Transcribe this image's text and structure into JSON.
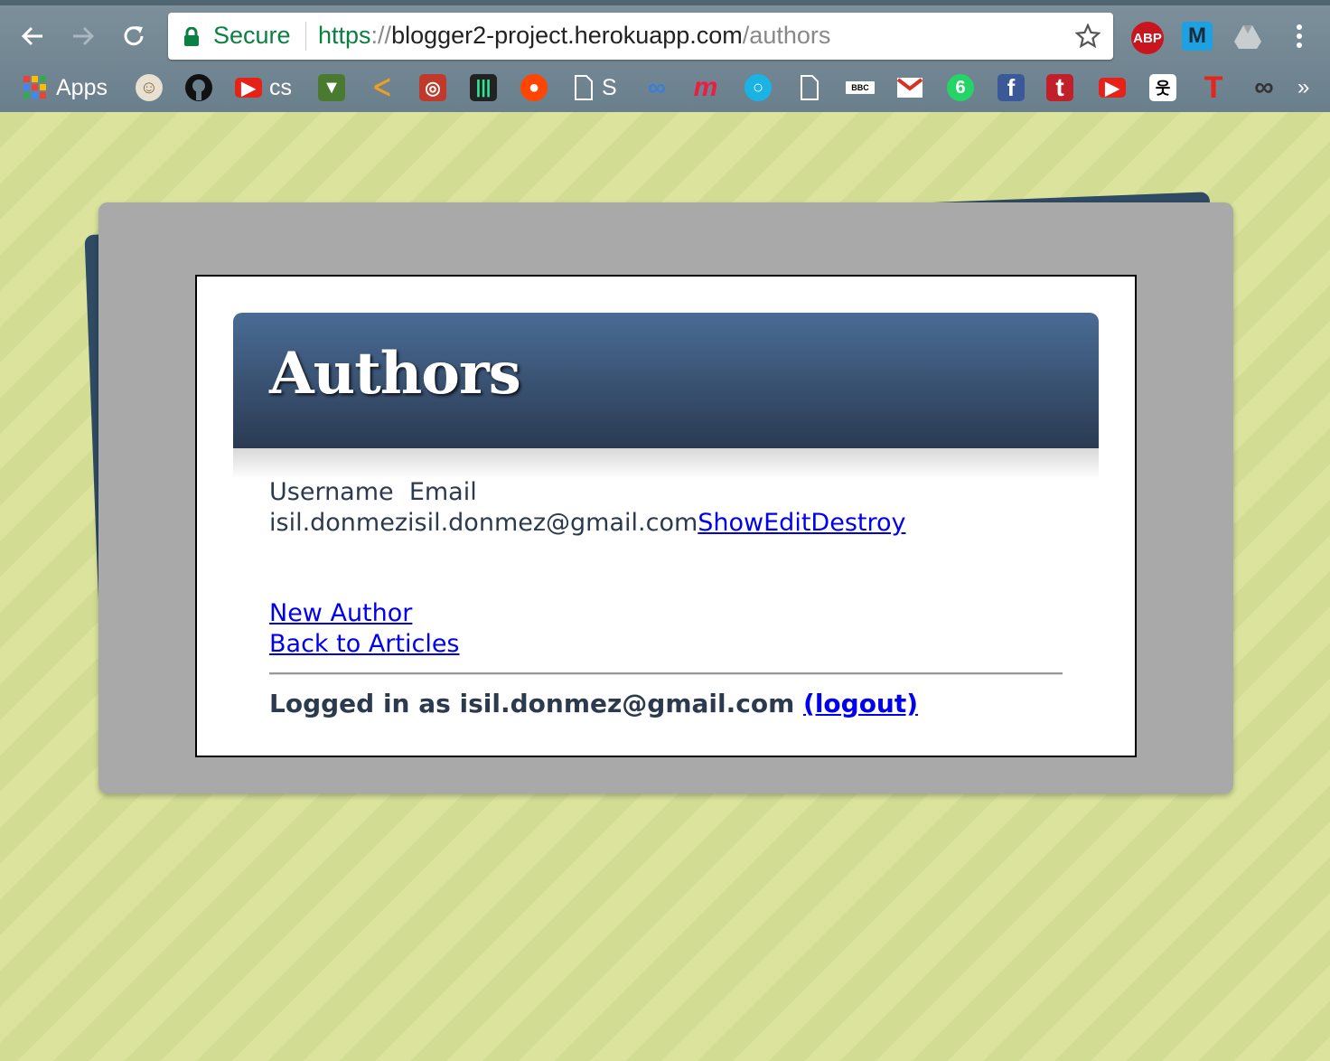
{
  "browser": {
    "secure_label": "Secure",
    "url_scheme": "https",
    "url_sep": "://",
    "url_host": "blogger2-project.herokuapp.com",
    "url_path": "/authors",
    "extensions": [
      {
        "label": "ABP",
        "color": "#d0021b"
      },
      {
        "label": "M",
        "color": "#1da1e0"
      }
    ]
  },
  "bookmarks": {
    "apps_label": "Apps",
    "cs_label": "cs",
    "s_label": "S",
    "bbc_label": "BBC",
    "six_label": "6",
    "f_label": "f",
    "t_label": "t",
    "T_label": "T"
  },
  "page": {
    "title": "Authors",
    "table": {
      "headers": [
        "Username",
        "Email"
      ],
      "rows": [
        {
          "username": "isil.donmez",
          "email": "isil.donmez@gmail.com",
          "actions": [
            "Show",
            "Edit",
            "Destroy"
          ]
        }
      ]
    },
    "new_author_link": "New Author",
    "back_link": "Back to Articles",
    "logged_in_text": "Logged in as isil.donmez@gmail.com",
    "logout_link": "(logout)"
  }
}
